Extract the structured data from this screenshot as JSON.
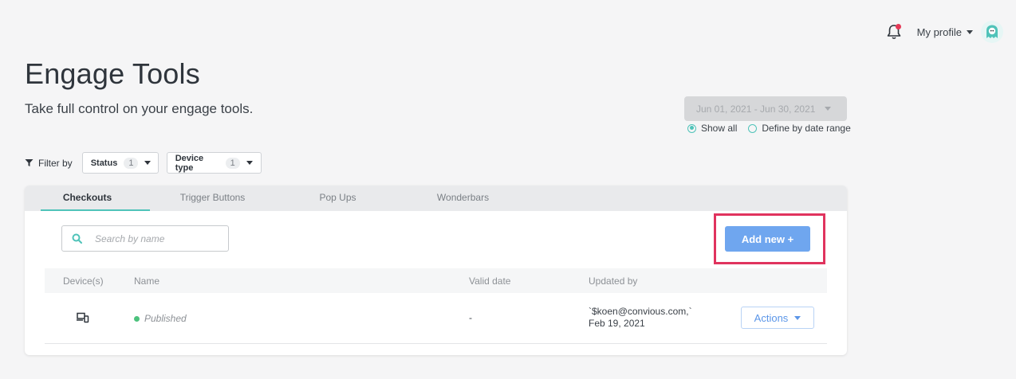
{
  "header": {
    "profile_label": "My profile",
    "notification_icon": "bell-icon",
    "colors": {
      "notification_dot": "#e53957",
      "accent": "#4fc3b9"
    }
  },
  "page": {
    "title": "Engage Tools",
    "subtitle": "Take full control on your engage tools."
  },
  "date_filter": {
    "range": "Jun 01, 2021 - Jun 30, 2021",
    "options": [
      {
        "label": "Show all",
        "selected": true
      },
      {
        "label": "Define by date range",
        "selected": false
      }
    ]
  },
  "filters": {
    "label": "Filter by",
    "items": [
      {
        "label": "Status",
        "count": "1"
      },
      {
        "label": "Device type",
        "count": "1"
      }
    ]
  },
  "tabs": [
    {
      "label": "Checkouts",
      "active": true
    },
    {
      "label": "Trigger Buttons",
      "active": false
    },
    {
      "label": "Pop Ups",
      "active": false
    },
    {
      "label": "Wonderbars",
      "active": false
    }
  ],
  "search": {
    "placeholder": "Search by name"
  },
  "add_button": {
    "label": "Add new +",
    "color": "#6fa6ef",
    "highlight_color": "#e0335e"
  },
  "table": {
    "columns": [
      "Device(s)",
      "Name",
      "Valid date",
      "Updated by"
    ],
    "rows": [
      {
        "device_icon": "devices-icon",
        "status": "Published",
        "status_color": "#4cc27d",
        "valid_date": "-",
        "updated_by_line1": "`$koen@convious.com,`",
        "updated_by_line2": "Feb 19, 2021",
        "actions_label": "Actions"
      }
    ]
  }
}
